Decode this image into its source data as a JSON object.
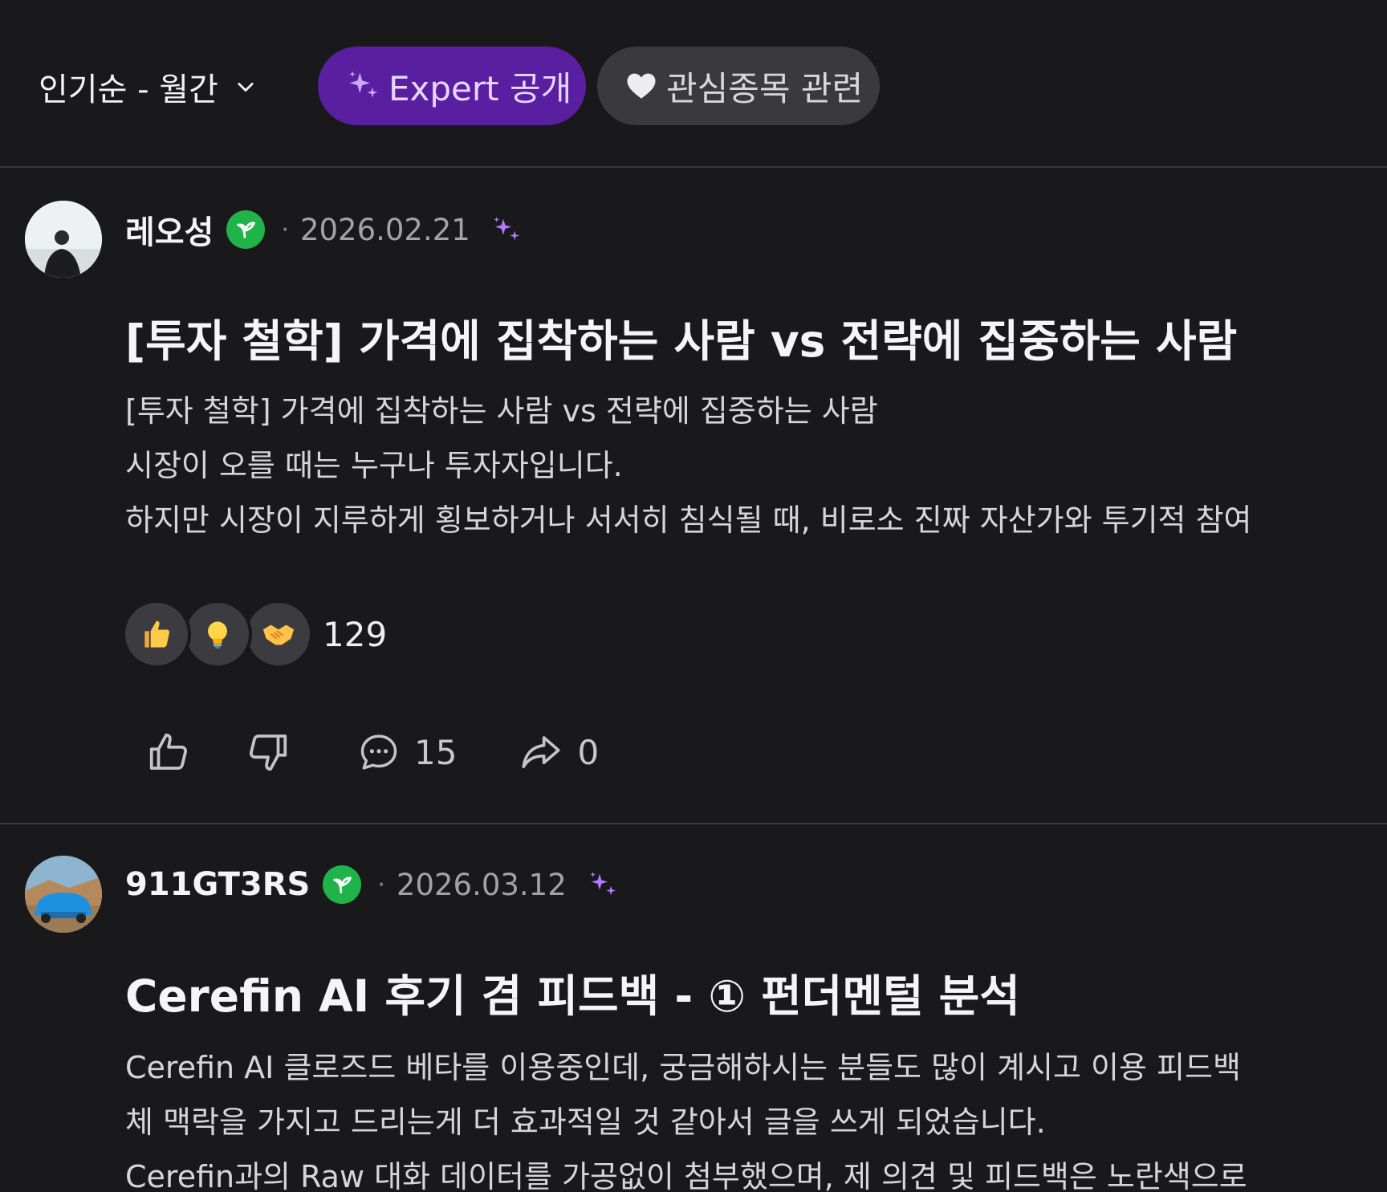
{
  "filter": {
    "sort_label": "인기순 - 월간",
    "chips": [
      {
        "label": "Expert 공개",
        "icon": "sparkle-icon",
        "accent": "#5a1fa0"
      },
      {
        "label": "관심종목 관련",
        "icon": "heart-icon"
      }
    ]
  },
  "posts": [
    {
      "author": "레오성",
      "badge_icon": "sprout-icon",
      "date": "2026.02.21",
      "title": "[투자 철학] 가격에 집착하는 사람 vs 전략에 집중하는 사람",
      "body_lines": [
        "[투자 철학] 가격에 집착하는 사람 vs 전략에 집중하는 사람",
        "시장이 오를 때는 누구나 투자자입니다.",
        "하지만 시장이 지루하게 횡보하거나 서서히 침식될 때, 비로소 진짜 자산가와 투기적 참여"
      ],
      "reactions": [
        "thumbs-up",
        "light-bulb",
        "handshake"
      ],
      "reaction_count": "129",
      "comment_count": "15",
      "share_count": "0"
    },
    {
      "author": "911GT3RS",
      "badge_icon": "sprout-icon",
      "date": "2026.03.12",
      "title": "Cerefin AI 후기 겸 피드백 - ① 펀더멘털 분석",
      "body_lines": [
        "Cerefin AI 클로즈드 베타를 이용중인데, 궁금해하시는 분들도 많이 계시고 이용 피드백",
        "체 맥락을 가지고 드리는게 더 효과적일 것 같아서 글을 쓰게 되었습니다.",
        "Cerefin과의 Raw 대화 데이터를 가공없이 첨부했으며, 제 의견 및 피드백은 노란색으로"
      ]
    }
  ],
  "colors": {
    "background": "#19191b",
    "badge_green": "#1fb34a",
    "ai_sparkle": "#b07cff"
  }
}
